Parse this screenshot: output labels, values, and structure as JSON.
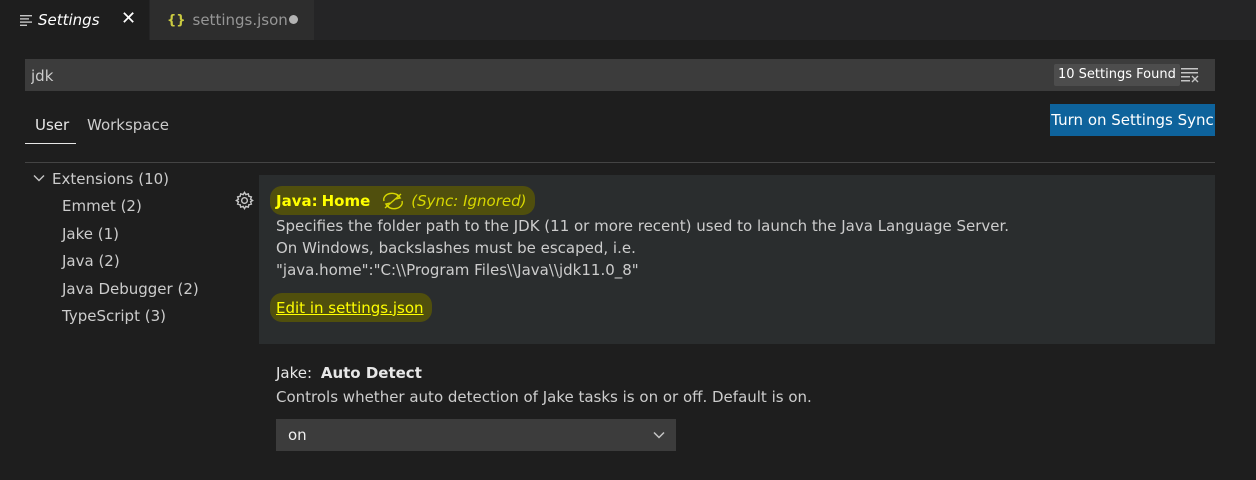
{
  "tabs": [
    {
      "label": "Settings",
      "close": "✕"
    },
    {
      "label": "settings.json",
      "icon": "{}"
    }
  ],
  "search": {
    "value": "jdk",
    "results_badge": "10 Settings Found"
  },
  "scope_tabs": {
    "user": "User",
    "workspace": "Workspace"
  },
  "sync_button": "Turn on Settings Sync",
  "toc": {
    "root": "Extensions (10)",
    "items": [
      "Emmet (2)",
      "Jake (1)",
      "Java (2)",
      "Java Debugger (2)",
      "TypeScript (3)"
    ]
  },
  "settings": [
    {
      "category": "Java:",
      "name": "Home",
      "sync_tag": "(Sync: Ignored)",
      "description": [
        "Specifies the folder path to the JDK (11 or more recent) used to launch the Java Language Server.",
        "On Windows, backslashes must be escaped, i.e.",
        "\"java.home\":\"C:\\\\Program Files\\\\Java\\\\jdk11.0_8\""
      ],
      "edit_link": "Edit in settings.json"
    },
    {
      "category": "Jake:",
      "name": "Auto Detect",
      "description": "Controls whether auto detection of Jake tasks is on or off. Default is on.",
      "value": "on"
    }
  ],
  "colors": {
    "accent_button": "#0e639c",
    "highlight": "#ffff00",
    "background": "#1e1e1e"
  }
}
